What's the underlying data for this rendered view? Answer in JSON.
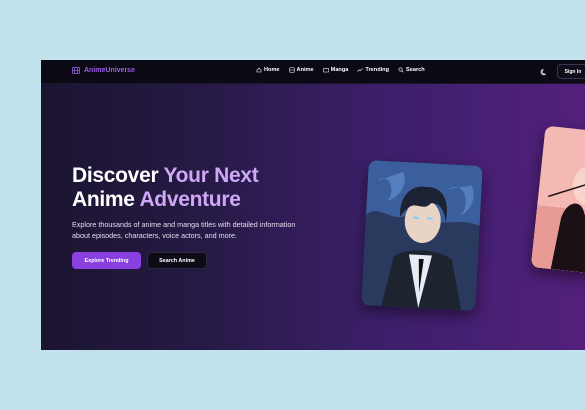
{
  "nav": {
    "brand": "AnimeUniverse",
    "links": [
      {
        "label": "Home",
        "icon": "home-icon"
      },
      {
        "label": "Anime",
        "icon": "film-icon"
      },
      {
        "label": "Manga",
        "icon": "book-icon"
      },
      {
        "label": "Trending",
        "icon": "trending-icon"
      },
      {
        "label": "Search",
        "icon": "search-icon"
      }
    ],
    "theme_icon": "moon-icon",
    "signin_label": "Sign In"
  },
  "hero": {
    "title_line1_plain": "Discover ",
    "title_line1_accent": "Your Next",
    "title_line2_plain": "Anime ",
    "title_line2_accent": "Adventure",
    "description": "Explore thousands of anime and manga titles with detailed information about episodes, characters, voice actors, and more.",
    "primary_button": "Explore Trending",
    "secondary_button": "Search Anime"
  },
  "colors": {
    "accent": "#9b5de5",
    "accent_light": "#cfa8f5",
    "primary_button": "#8a3fe0",
    "nav_bg": "#0b0a14"
  }
}
